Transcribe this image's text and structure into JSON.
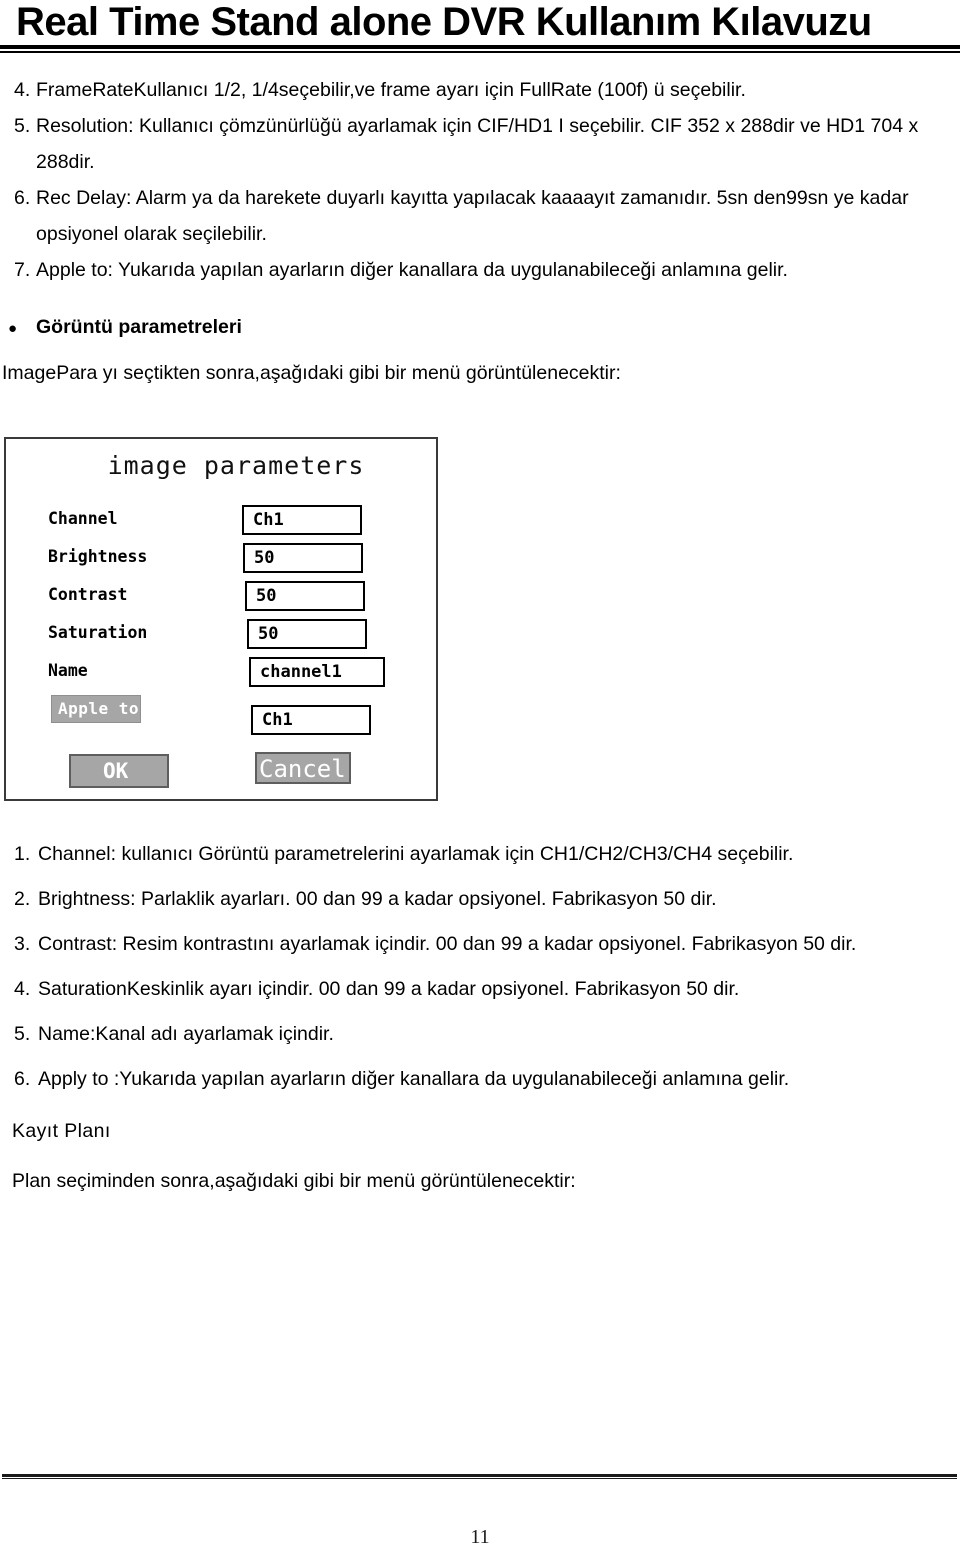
{
  "header": {
    "title": "Real Time Stand alone DVR Kullanım Kılavuzu"
  },
  "main_list": [
    {
      "num": "4.",
      "text": "FrameRateKullanıcı 1/2, 1/4seçebilir,ve frame ayarı için FullRate (100f) ü seçebilir."
    },
    {
      "num": "5.",
      "text": "Resolution: Kullanıcı çömzünürlüğü ayarlamak için   CIF/HD1 I seçebilir. CIF 352 x 288dir ve HD1 704 x 288dir."
    },
    {
      "num": "6.",
      "text": "Rec Delay: Alarm ya da harekete duyarlı kayıtta yapılacak kaaaayıt zamanıdır. 5sn den99sn ye kadar opsiyonel olarak seçilebilir."
    },
    {
      "num": "7.",
      "text": "Apple to: Yukarıda yapılan ayarların diğer kanallara da uygulanabileceği anlamına gelir."
    }
  ],
  "bullet": {
    "marker": "●",
    "label": "Görüntü parametreleri"
  },
  "intro_paragraph": "ImagePara yı seçtikten sonra,aşağıdaki gibi bir menü görüntülenecektir:",
  "dialog": {
    "title": "image parameters",
    "rows": [
      {
        "label": "Channel",
        "value": "Ch1"
      },
      {
        "label": "Brightness",
        "value": "50"
      },
      {
        "label": "Contrast",
        "value": "50"
      },
      {
        "label": "Saturation",
        "value": "50"
      },
      {
        "label": "Name",
        "value": "channel1"
      }
    ],
    "apply_button": "Apple to",
    "apply_value": "Ch1",
    "ok_button": "OK",
    "cancel_button": "Cancel",
    "colors": {
      "button_bg": "#a6a6a6",
      "button_text": "#ffffff",
      "border": "#000000",
      "dialog_border": "#3a3a3a",
      "dialog_bg": "#ffffff"
    }
  },
  "explain_list": [
    {
      "num": "1.",
      "text": "Channel: kullanıcı Görüntü parametrelerini ayarlamak için CH1/CH2/CH3/CH4 seçebilir."
    },
    {
      "num": "2.",
      "text": "Brightness: Parlaklik ayarları. 00 dan 99 a kadar opsiyonel. Fabrikasyon 50 dir."
    },
    {
      "num": "3.",
      "text": "Contrast: Resim kontrastını ayarlamak içindir. 00 dan 99 a kadar opsiyonel. Fabrikasyon 50 dir."
    },
    {
      "num": "4.",
      "text": "SaturationKeskinlik ayarı içindir. 00 dan 99 a kadar opsiyonel. Fabrikasyon 50 dir."
    },
    {
      "num": "5.",
      "text": "Name:Kanal adı ayarlamak içindir."
    },
    {
      "num": "6.",
      "text": "Apply to :Yukarıda yapılan ayarların diğer kanallara da uygulanabileceği anlamına gelir."
    }
  ],
  "tail": {
    "heading": "Kayıt Planı",
    "paragraph": "Plan seçiminden sonra,aşağıdaki gibi bir menü görüntülenecektir:"
  },
  "footer": {
    "page_number": "11"
  }
}
